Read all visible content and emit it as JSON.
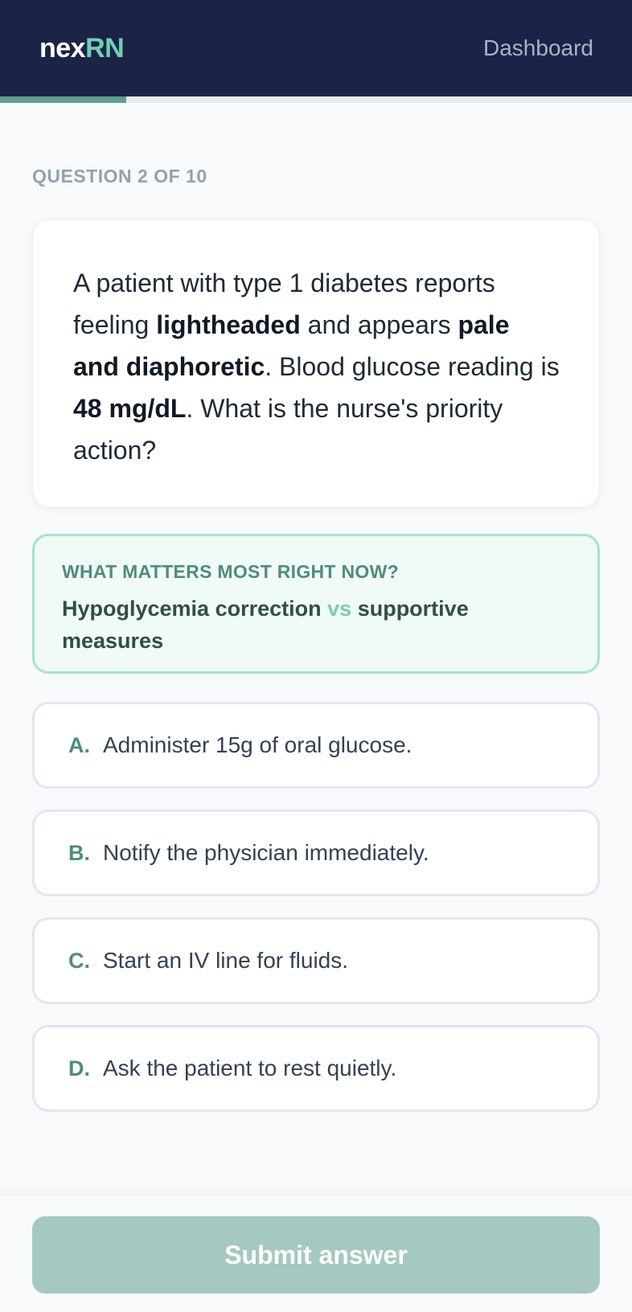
{
  "header": {
    "logo_part1": "nex",
    "logo_part2": "RN",
    "nav_link": "Dashboard"
  },
  "progress": {
    "current": 2,
    "total": 10,
    "fraction": 0.2
  },
  "question": {
    "label": "QUESTION 2 OF 10",
    "segments": [
      {
        "text": "A patient with type 1 diabetes reports feeling ",
        "bold": false
      },
      {
        "text": "lightheaded",
        "bold": true
      },
      {
        "text": " and appears ",
        "bold": false
      },
      {
        "text": "pale and diaphoretic",
        "bold": true
      },
      {
        "text": ". Blood glucose reading is ",
        "bold": false
      },
      {
        "text": "48 mg/dL",
        "bold": true
      },
      {
        "text": ". What is the nurse's priority action?",
        "bold": false
      }
    ]
  },
  "hint": {
    "title": "WHAT MATTERS MOST RIGHT NOW?",
    "part1": "Hypoglycemia correction",
    "vs": "vs",
    "part2": "supportive measures"
  },
  "options": [
    {
      "letter": "A.",
      "text": "Administer 15g of oral glucose."
    },
    {
      "letter": "B.",
      "text": "Notify the physician immediately."
    },
    {
      "letter": "C.",
      "text": "Start an IV line for fluids."
    },
    {
      "letter": "D.",
      "text": "Ask the patient to rest quietly."
    }
  ],
  "footer": {
    "submit_label": "Submit answer"
  },
  "colors": {
    "header_bg": "#1b2446",
    "accent": "#6fcfb3",
    "accent_dark": "#4e8d7d",
    "submit_disabled": "#a5c8c1"
  }
}
